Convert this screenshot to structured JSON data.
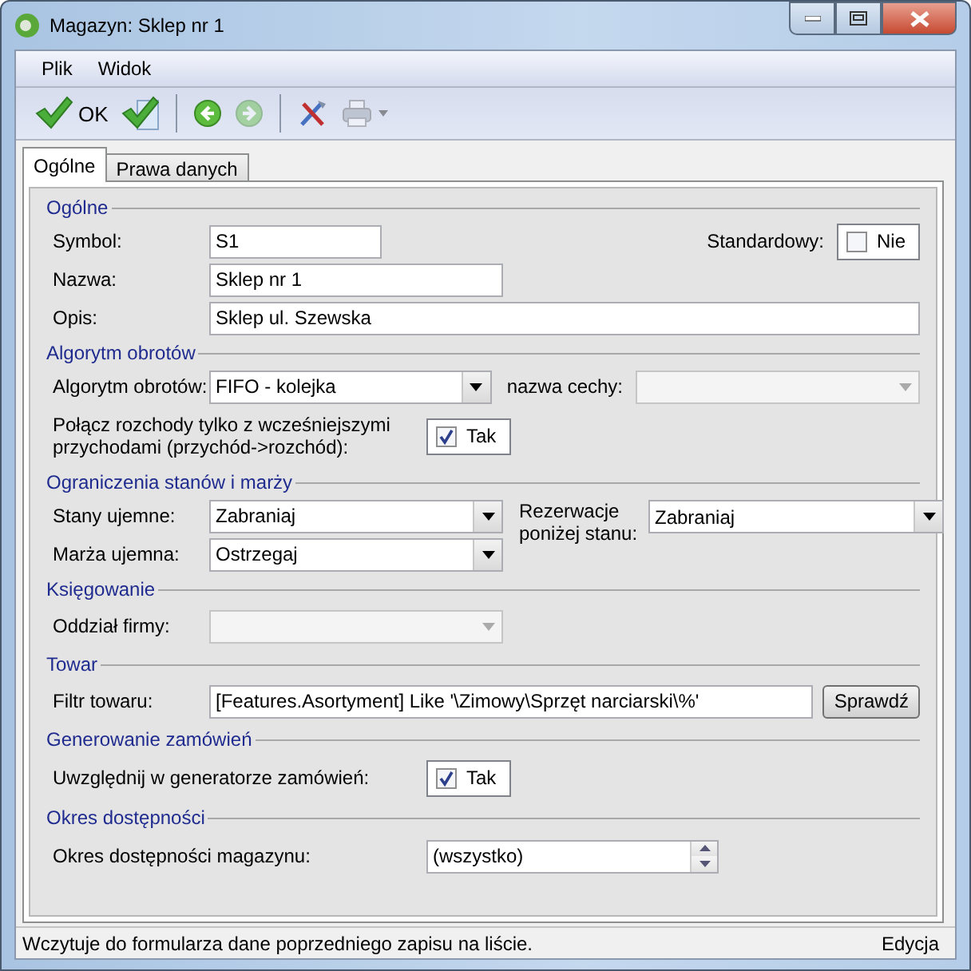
{
  "window": {
    "title": "Magazyn: Sklep nr 1"
  },
  "menu": [
    {
      "label": "Plik"
    },
    {
      "label": "Widok"
    }
  ],
  "toolbar": [
    {
      "kind": "ok",
      "label": "OK",
      "disabled": false
    },
    {
      "kind": "save",
      "disabled": false
    },
    {
      "kind": "separator"
    },
    {
      "kind": "back",
      "disabled": false
    },
    {
      "kind": "forward",
      "disabled": true
    },
    {
      "kind": "separator"
    },
    {
      "kind": "tools",
      "disabled": false
    },
    {
      "kind": "print",
      "disabled": true
    }
  ],
  "tabs": [
    {
      "label": "Ogólne",
      "selected": true
    },
    {
      "label": "Prawa danych",
      "selected": false
    }
  ],
  "sections": [
    {
      "title": "Ogólne",
      "fields": [
        {
          "kind": "text",
          "label": "Symbol:",
          "value": "S1"
        },
        {
          "kind": "checkbox",
          "label": "Standardowy:",
          "text": "Nie",
          "checked": false
        },
        {
          "kind": "text",
          "label": "Nazwa:",
          "value": "Sklep nr 1"
        },
        {
          "kind": "text",
          "label": "Opis:",
          "value": "Sklep ul. Szewska"
        }
      ]
    },
    {
      "title": "Algorytm obrotów",
      "fields": [
        {
          "kind": "combo",
          "label": "Algorytm obrotów:",
          "value": "FIFO - kolejka",
          "disabled": false
        },
        {
          "kind": "combo",
          "label": "nazwa cechy:",
          "disabled": true
        },
        {
          "kind": "checkbox",
          "label": "Połącz rozchody tylko z wcześniejszymi przychodami (przychód->rozchód):",
          "text": "Tak",
          "checked": true
        }
      ]
    },
    {
      "title": "Ograniczenia stanów i marży",
      "fields": [
        {
          "kind": "combo",
          "label": "Stany ujemne:",
          "value": "Zabraniaj",
          "disabled": false
        },
        {
          "kind": "combo",
          "label": "Marża ujemna:",
          "value": "Ostrzegaj",
          "disabled": false
        },
        {
          "kind": "combo",
          "label": "Rezerwacje poniżej stanu:",
          "value": "Zabraniaj",
          "disabled": false
        }
      ]
    },
    {
      "title": "Księgowanie",
      "fields": [
        {
          "kind": "combo",
          "label": "Oddział firmy:",
          "disabled": true
        }
      ]
    },
    {
      "title": "Towar",
      "fields": [
        {
          "kind": "text",
          "label": "Filtr towaru:",
          "value": "[Features.Asortyment] Like '\\Zimowy\\Sprzęt narciarski\\%'",
          "button": "Sprawdź"
        }
      ]
    },
    {
      "title": "Generowanie zamówień",
      "fields": [
        {
          "kind": "checkbox",
          "label": "Uwzględnij w generatorze zamówień:",
          "text": "Tak",
          "checked": true
        }
      ]
    },
    {
      "title": "Okres dostępności",
      "fields": [
        {
          "kind": "spin",
          "label": "Okres dostępności magazynu:",
          "value": "(wszystko)"
        }
      ]
    }
  ],
  "status_bar": {
    "message": "Wczytuje do formularza dane poprzedniego zapisu na liście.",
    "mode": "Edycja"
  }
}
